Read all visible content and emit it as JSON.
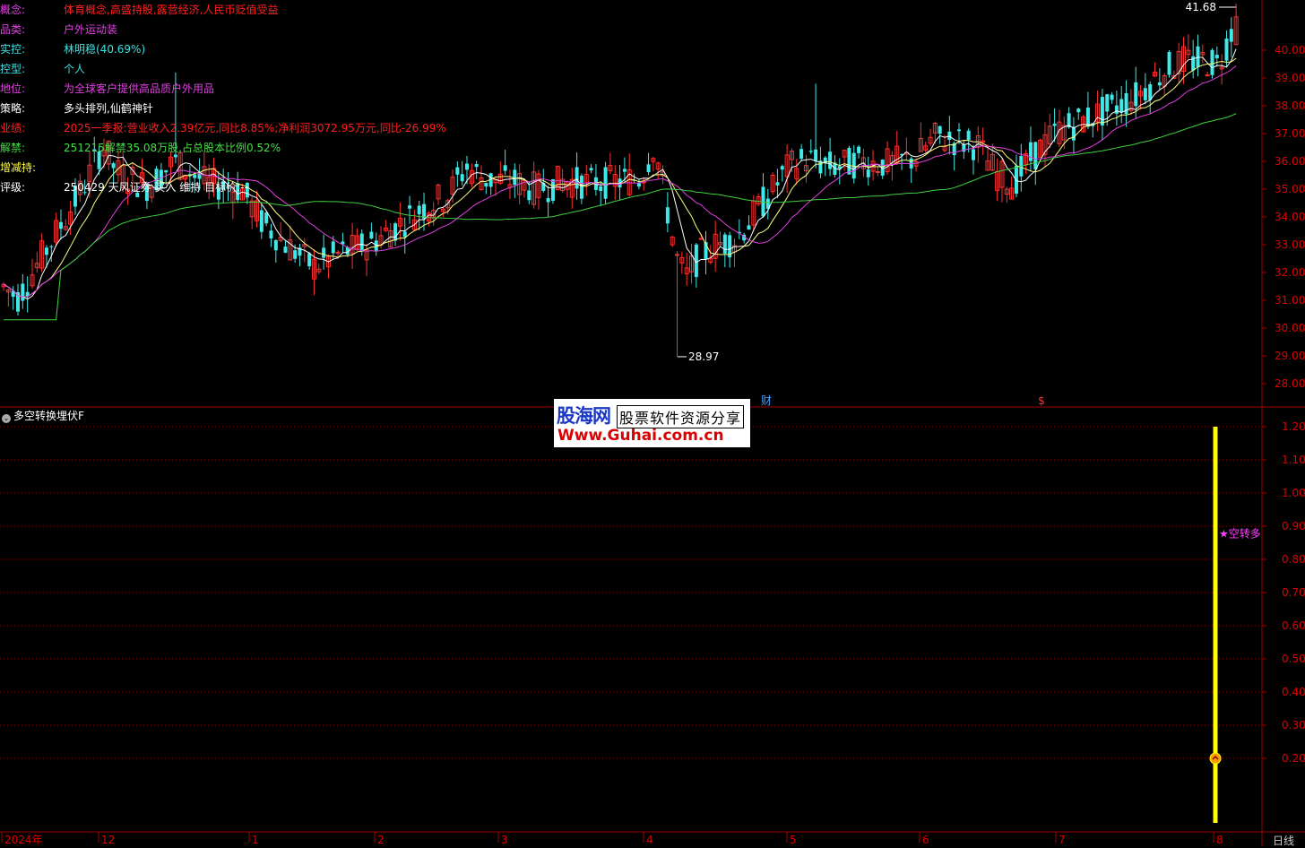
{
  "stock_info": [
    {
      "label": "概念:",
      "value": "体育概念,高盛持股,露营经济,人民币贬值受益",
      "label_color": "#e040e0",
      "value_color": "#ff2020"
    },
    {
      "label": "品类:",
      "value": "户外运动装",
      "label_color": "#e040e0",
      "value_color": "#e040e0"
    },
    {
      "label": "实控:",
      "value": "林明稳(40.69%)",
      "label_color": "#40e0e0",
      "value_color": "#40e0e0"
    },
    {
      "label": "控型:",
      "value": "个人",
      "label_color": "#40e0e0",
      "value_color": "#40e0e0"
    },
    {
      "label": "地位:",
      "value": "为全球客户提供高品质户外用品",
      "label_color": "#e040e0",
      "value_color": "#e040e0"
    },
    {
      "label": "策略:",
      "value": "多头排列,仙鹤神针",
      "label_color": "#ffffff",
      "value_color": "#ffffff"
    },
    {
      "label": "业绩:",
      "value": "2025一季报:营业收入2.39亿元,同比8.85%;净利润3072.95万元,同比-26.99%",
      "label_color": "#ff2020",
      "value_color": "#ff2020"
    },
    {
      "label": "解禁:",
      "value": "251215解禁35.08万股,占总股本比例0.52%",
      "label_color": "#40e040",
      "value_color": "#40e040"
    },
    {
      "label": "增减持:",
      "value": "",
      "label_color": "#ffff40",
      "value_color": "#ffff40"
    },
    {
      "label": "评级:",
      "value": "250429 天风证券 买入 维持 目标价:--",
      "label_color": "#ffffff",
      "value_color": "#ffffff"
    }
  ],
  "price_axis": {
    "ticks": [
      "40.00",
      "39.00",
      "38.00",
      "37.00",
      "36.00",
      "35.00",
      "34.00",
      "33.00",
      "32.00",
      "31.00",
      "30.00",
      "29.00",
      "28.00"
    ],
    "values": [
      40,
      39,
      38,
      37,
      36,
      35,
      34,
      33,
      32,
      31,
      30,
      29,
      28
    ]
  },
  "high_label": "41.68",
  "low_label": "28.97",
  "events": [
    {
      "text": "财",
      "color": "#40a0ff"
    },
    {
      "text": "$",
      "color": "#ff3030"
    }
  ],
  "indicator": {
    "title": "多空转换埋伏F",
    "axis_ticks": [
      "1.20",
      "1.10",
      "1.00",
      "0.90",
      "0.80",
      "0.70",
      "0.60",
      "0.50",
      "0.40",
      "0.30",
      "0.20"
    ],
    "axis_values": [
      1.2,
      1.1,
      1.0,
      0.9,
      0.8,
      0.7,
      0.6,
      0.5,
      0.4,
      0.3,
      0.2
    ],
    "signal_label": "★空转多",
    "signal_value": 0.88,
    "bar_top_value": 1.2,
    "marker_value": 0.2,
    "bar_color": "#ffff00"
  },
  "watermark": {
    "line1": "股海网",
    "line1b": "股票软件资源分享",
    "line2": "Www.Guhai.com.cn"
  },
  "time_axis": [
    "2024年",
    "12",
    "1",
    "2",
    "3",
    "4",
    "5",
    "6",
    "7",
    "8"
  ],
  "period": "日线",
  "colors": {
    "up": "#ff3030",
    "down": "#40e8e8",
    "ma5": "#ffffff",
    "ma10": "#ffff80",
    "ma20": "#e040e0",
    "ma60": "#40d040",
    "grid": "#8b0000",
    "axis": "#a00000"
  }
}
